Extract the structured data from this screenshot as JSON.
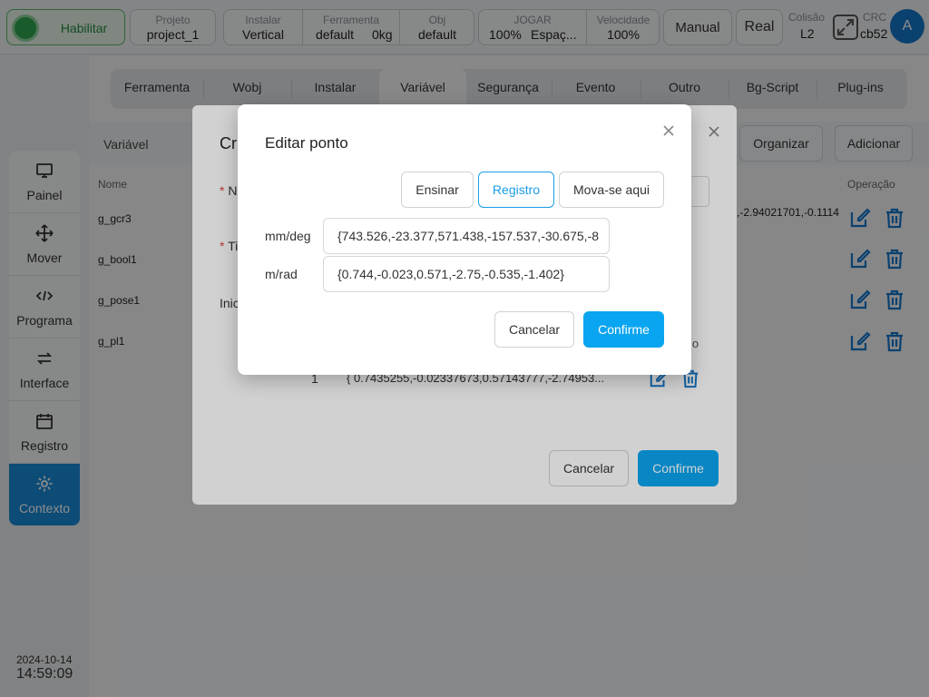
{
  "topbar": {
    "enable": "Habilitar",
    "project": {
      "label": "Projeto",
      "value": "project_1"
    },
    "install": {
      "label": "Instalar",
      "value": "Vertical"
    },
    "tool": {
      "label": "Ferramenta",
      "value": "default",
      "weight": "0kg"
    },
    "obj": {
      "label": "Obj",
      "value": "default"
    },
    "jog": {
      "label": "JOGAR",
      "value": "100%",
      "value2": "Espaç..."
    },
    "speed": {
      "label": "Velocidade",
      "value": "100%"
    },
    "mode": "Manual",
    "real": "Real",
    "collision": {
      "label": "Colisão",
      "value": "L2"
    },
    "crc": {
      "label": "CRC",
      "value": "cb52"
    },
    "avatar": "A"
  },
  "sidebar": {
    "items": [
      {
        "label": "Painel",
        "icon": "monitor-icon"
      },
      {
        "label": "Mover",
        "icon": "move-icon"
      },
      {
        "label": "Programa",
        "icon": "code-icon"
      },
      {
        "label": "Interface",
        "icon": "swap-icon"
      },
      {
        "label": "Registro",
        "icon": "calendar-icon"
      },
      {
        "label": "Contexto",
        "icon": "gear-icon"
      }
    ],
    "date": "2024-10-14",
    "time": "14:59:09"
  },
  "tabs": [
    "Ferramenta",
    "Wobj",
    "Instalar",
    "Variável",
    "Segurança",
    "Evento",
    "Outro",
    "Bg-Script",
    "Plug-ins"
  ],
  "panel": {
    "title": "Variável",
    "organize": "Organizar",
    "add": "Adicionar",
    "col_name": "Nome",
    "col_op": "Operação",
    "rows": [
      "g_gcr3",
      "g_bool1",
      "g_pose1",
      "g_pl1"
    ],
    "row_value": ",-2.94021701,-0.1114"
  },
  "create_dialog": {
    "title": "Cr",
    "field1": "N",
    "field2": "Ti",
    "init": "Inic",
    "col_suffix": "io",
    "row_index": "1",
    "row_value": "{ 0.7435255,-0.02337673,0.57143777,-2.74953...",
    "cancel": "Cancelar",
    "confirm": "Confirme"
  },
  "edit_dialog": {
    "title": "Editar ponto",
    "teach": "Ensinar",
    "record": "Registro",
    "move_here": "Mova-se aqui",
    "label_mm": "mm/deg",
    "value_mm": "{743.526,-23.377,571.438,-157.537,-30.675,-8",
    "label_m": "m/rad",
    "value_m": "{0.744,-0.023,0.571,-2.75,-0.535,-1.402}",
    "cancel": "Cancelar",
    "confirm": "Confirme"
  },
  "colors": {
    "accent": "#0aa5f0",
    "active_nav": "#1a8ad6",
    "enable_green": "#2ea44f"
  }
}
